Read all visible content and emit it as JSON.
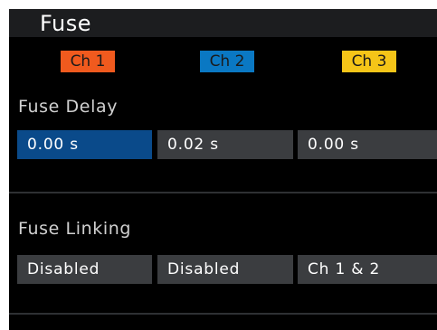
{
  "title": "Fuse",
  "channels": [
    {
      "label": "Ch 1",
      "bg": "#f05a1e",
      "fg": "#1a1a1a"
    },
    {
      "label": "Ch 2",
      "bg": "#0a78c3",
      "fg": "#1a1a1a"
    },
    {
      "label": "Ch 3",
      "bg": "#f5c518",
      "fg": "#1a1a1a"
    }
  ],
  "fuse_delay": {
    "label": "Fuse Delay",
    "values": [
      "0.00 s",
      "0.02 s",
      "0.00 s"
    ],
    "selected_index": 0
  },
  "fuse_linking": {
    "label": "Fuse Linking",
    "values": [
      "Disabled",
      "Disabled",
      "Ch 1 & 2"
    ]
  },
  "colors": {
    "background": "#000000",
    "field": "#3b3d40",
    "selected_field": "#0a4a8a",
    "label_text": "#d0d0d0"
  }
}
